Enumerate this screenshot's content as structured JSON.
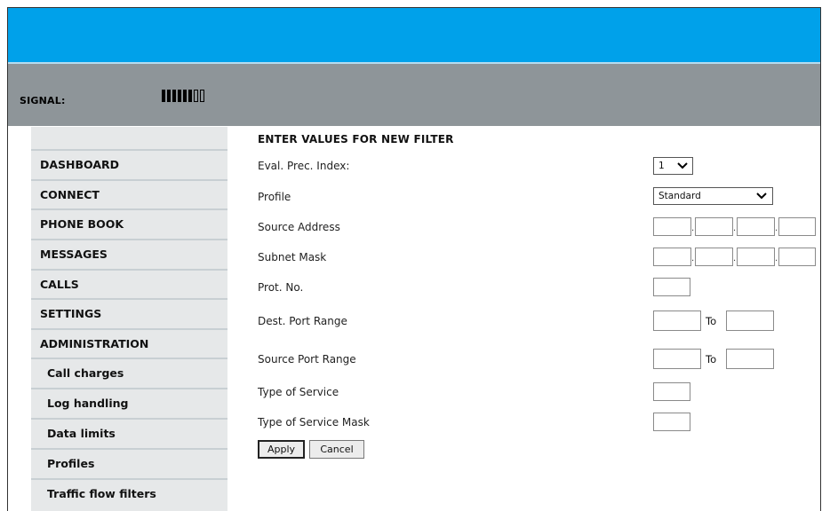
{
  "header": {
    "signal_label": "SIGNAL:",
    "signal_level": "6 of 8 bars",
    "signal_bars": 6,
    "signal_total": 8
  },
  "sidebar": {
    "items": [
      {
        "label": "DASHBOARD",
        "level": "top"
      },
      {
        "label": "CONNECT",
        "level": "top"
      },
      {
        "label": "PHONE BOOK",
        "level": "top"
      },
      {
        "label": "MESSAGES",
        "level": "top"
      },
      {
        "label": "CALLS",
        "level": "top"
      },
      {
        "label": "SETTINGS",
        "level": "top"
      },
      {
        "label": "ADMINISTRATION",
        "level": "top"
      },
      {
        "label": "Call charges",
        "level": "sub"
      },
      {
        "label": "Log handling",
        "level": "sub"
      },
      {
        "label": "Data limits",
        "level": "sub"
      },
      {
        "label": "Profiles",
        "level": "sub"
      },
      {
        "label": "Traffic flow filters",
        "level": "sub"
      }
    ]
  },
  "form": {
    "title": "ENTER VALUES FOR NEW FILTER",
    "eval_prec_index_label": "Eval. Prec. Index:",
    "eval_prec_index_value": "1",
    "profile_label": "Profile",
    "profile_value": "Standard",
    "source_address_label": "Source Address",
    "subnet_mask_label": "Subnet Mask",
    "prot_no_label": "Prot. No.",
    "dest_port_range_label": "Dest. Port Range",
    "source_port_range_label": "Source Port Range",
    "to_label": "To",
    "type_of_service_label": "Type of Service",
    "type_of_service_mask_label": "Type of Service Mask",
    "apply_label": "Apply",
    "cancel_label": "Cancel"
  },
  "colors": {
    "top_bar": "#00a1ea",
    "signal_bar": "#8e9599",
    "sidebar_bg": "#e6e8e9"
  }
}
